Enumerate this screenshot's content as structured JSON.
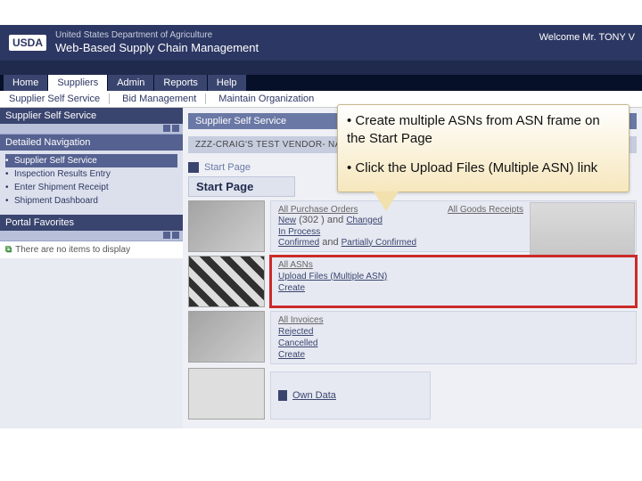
{
  "header": {
    "logo": "USDA",
    "department": "United States Department of Agriculture",
    "app_name": "Web-Based Supply Chain Management",
    "welcome": "Welcome Mr. TONY V"
  },
  "tabs": [
    "Home",
    "Suppliers",
    "Admin",
    "Reports",
    "Help"
  ],
  "subtabs": [
    "Supplier Self Service",
    "Bid Management",
    "Maintain Organization"
  ],
  "sidebar": {
    "self_service": "Supplier Self Service",
    "detailed_nav": "Detailed Navigation",
    "items": [
      "Supplier Self Service",
      "Inspection Results Entry",
      "Enter Shipment Receipt",
      "Shipment Dashboard"
    ],
    "portal_fav": "Portal Favorites",
    "fav_empty": "There are no items to display"
  },
  "content": {
    "panel_title": "Supplier Self Service",
    "vendor": "ZZZ-CRAIG'S TEST VENDOR- NAME CHA",
    "crumb": "Start Page",
    "start_title": "Start Page",
    "po": {
      "header": "All Purchase Orders",
      "new": "New",
      "new_count": "(302 )",
      "changed": "Changed",
      "and": "and",
      "inprocess": "In Process",
      "confirmed": "Confirmed",
      "partially": "Partially Confirmed"
    },
    "goods": {
      "header": "All Goods Receipts"
    },
    "asn": {
      "header": "All ASNs",
      "upload": "Upload Files (Multiple ASN)",
      "create": "Create"
    },
    "inv": {
      "header": "All Invoices",
      "rejected": "Rejected",
      "cancelled": "Cancelled",
      "create": "Create"
    },
    "own_data": "Own Data"
  },
  "callout": {
    "line1": "• Create multiple ASNs from ASN frame on the Start Page",
    "line2": "• Click the Upload Files (Multiple ASN) link"
  }
}
